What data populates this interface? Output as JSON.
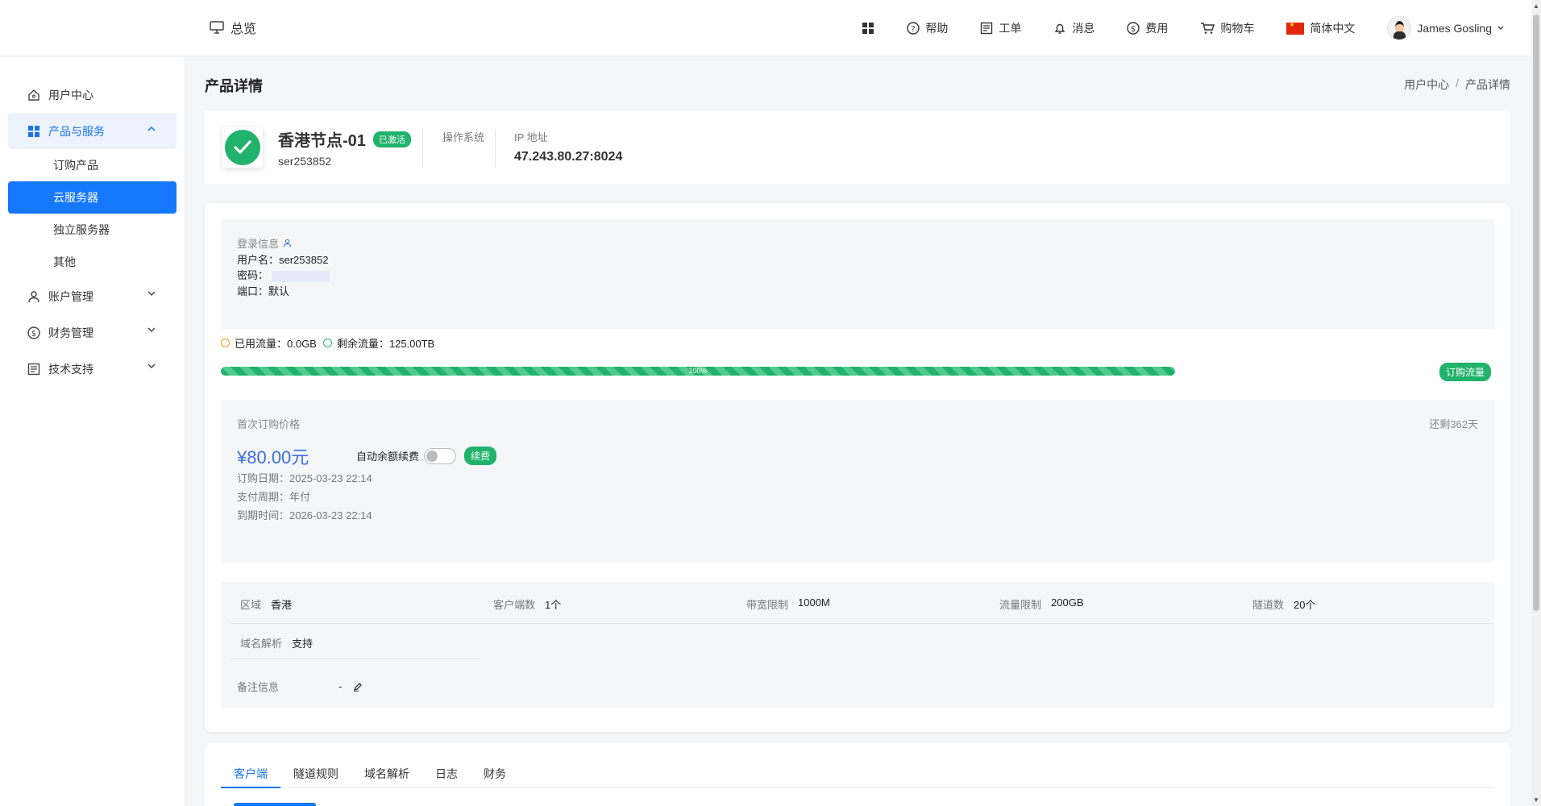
{
  "header": {
    "overview": "总览",
    "help": "帮助",
    "ticket": "工单",
    "message": "消息",
    "fee": "费用",
    "cart": "购物车",
    "language": "简体中文",
    "user": "James Gosling"
  },
  "sidebar": {
    "user_center": "用户中心",
    "products": "产品与服务",
    "products_sub": [
      "订购产品",
      "云服务器",
      "独立服务器",
      "其他"
    ],
    "account": "账户管理",
    "finance": "财务管理",
    "support": "技术支持"
  },
  "page": {
    "title": "产品详情",
    "breadcrumb": [
      "用户中心",
      "/",
      "产品详情"
    ]
  },
  "node": {
    "name": "香港节点-01",
    "status": "已激活",
    "id": "ser253852",
    "os_label": "操作系统",
    "ip_label": "IP 地址",
    "ip": "47.243.80.27:8024"
  },
  "login": {
    "title": "登录信息",
    "username": "用户名：ser253852",
    "password": "密码：",
    "port": "端口：默认"
  },
  "traffic": {
    "used": "已用流量：0.0GB",
    "remaining": "剩余流量：125.00TB",
    "percent_label": "100%",
    "percent": 100,
    "order_button": "订购流量",
    "used_color": "#f0a020",
    "remaining_color": "#21b26b"
  },
  "billing": {
    "first_price_label": "首次订购价格",
    "remaining_days": "还剩362天",
    "price": "¥80.00元",
    "auto_renew": "自动余额续费",
    "renew_button": "续费",
    "order_date": "订购日期：2025-03-23 22:14",
    "pay_cycle": "支付周期：年付",
    "expire": "到期时间：2026-03-23 22:14"
  },
  "specs": {
    "region_key": "区域",
    "region_val": "香港",
    "clients_key": "客户端数",
    "clients_val": "1个",
    "bandwidth_key": "带宽限制",
    "bandwidth_val": "1000M",
    "traffic_key": "流量限制",
    "traffic_val": "200GB",
    "tunnels_key": "隧道数",
    "tunnels_val": "20个",
    "dns_key": "域名解析",
    "dns_val": "支持",
    "remark_key": "备注信息",
    "remark_val": "-"
  },
  "tabs": [
    "客户端",
    "隧道规则",
    "域名解析",
    "日志",
    "财务"
  ],
  "colors": {
    "accent": "#1677ff",
    "green": "#21b26b",
    "price": "#3b6fe0"
  }
}
